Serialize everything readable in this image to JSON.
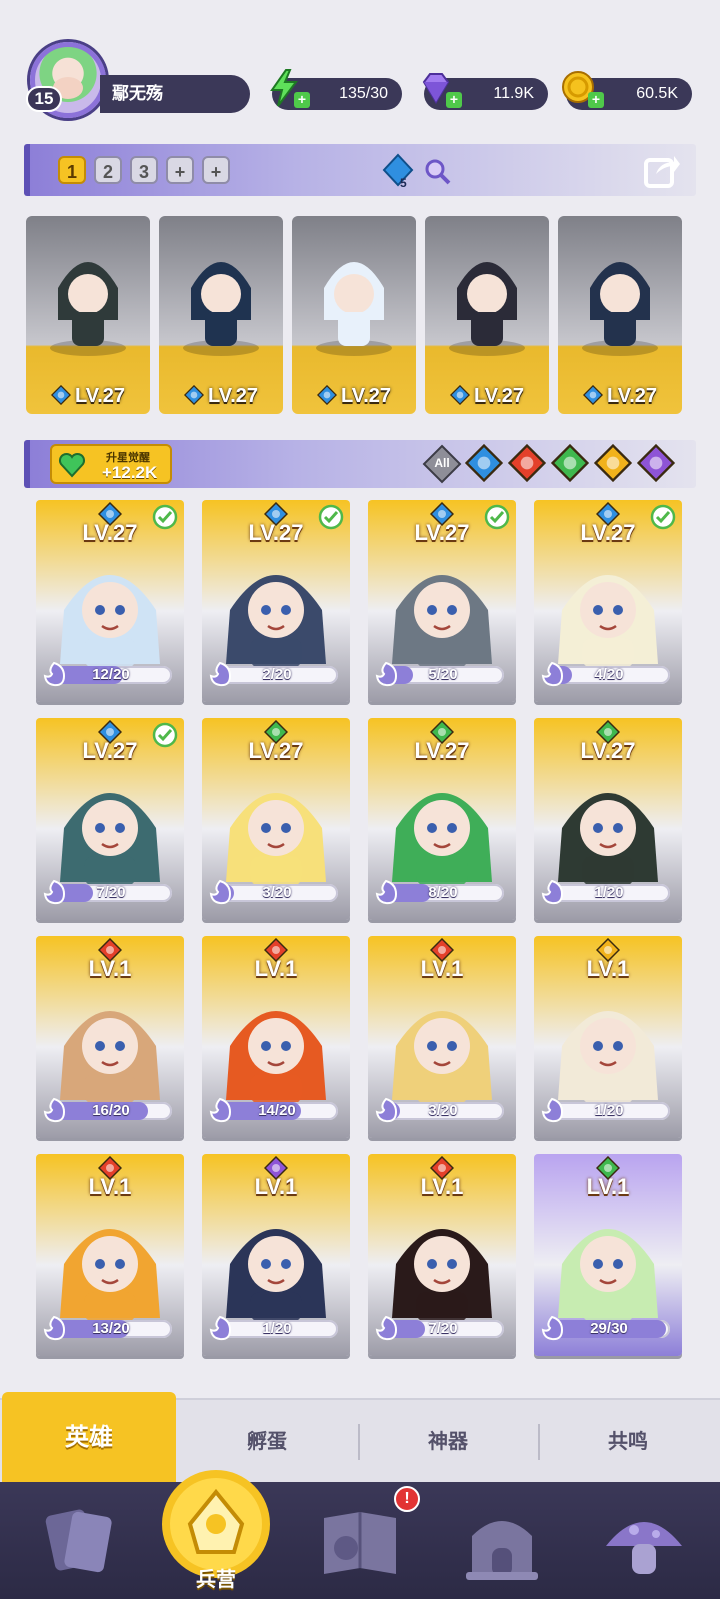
{
  "player": {
    "level": "15",
    "name": "鄢无殇"
  },
  "resources": [
    {
      "icon": "energy-bolt-icon",
      "value": "135/30"
    },
    {
      "icon": "diamond-icon",
      "value": "11.9K"
    },
    {
      "icon": "gold-coin-icon",
      "value": "60.5K"
    }
  ],
  "team_bar": {
    "slots": [
      "1",
      "2",
      "3",
      "+",
      "+"
    ],
    "active_slot": "1",
    "gem_count": "5"
  },
  "team_heroes": [
    {
      "level": "LV.27",
      "element": "water"
    },
    {
      "level": "LV.27",
      "element": "water"
    },
    {
      "level": "LV.27",
      "element": "water"
    },
    {
      "level": "LV.27",
      "element": "water"
    },
    {
      "level": "LV.27",
      "element": "water"
    }
  ],
  "awaken": {
    "label": "升星觉醒",
    "value": "+12.2K"
  },
  "filters": [
    "All",
    "water",
    "fire",
    "wind",
    "light",
    "dark"
  ],
  "colors": {
    "water": "#2f8fe0",
    "fire": "#e4402a",
    "wind": "#3fb84e",
    "light": "#f1b21b",
    "dark": "#8e54d6",
    "gold": "#f6c323",
    "purple": "#8d7fd8"
  },
  "heroes": [
    {
      "level": "LV.27",
      "element": "water",
      "shards": "12/20",
      "progress": 0.6,
      "checked": true,
      "rarity": "gold",
      "hair": "#cfe3f5"
    },
    {
      "level": "LV.27",
      "element": "water",
      "shards": "2/20",
      "progress": 0.1,
      "checked": true,
      "rarity": "gold",
      "hair": "#3b4a6b"
    },
    {
      "level": "LV.27",
      "element": "water",
      "shards": "5/20",
      "progress": 0.25,
      "checked": true,
      "rarity": "gold",
      "hair": "#6d7884"
    },
    {
      "level": "LV.27",
      "element": "water",
      "shards": "4/20",
      "progress": 0.2,
      "checked": true,
      "rarity": "gold",
      "hair": "#f4efd6"
    },
    {
      "level": "LV.27",
      "element": "water",
      "shards": "7/20",
      "progress": 0.35,
      "checked": true,
      "rarity": "gold",
      "hair": "#3d6b70"
    },
    {
      "level": "LV.27",
      "element": "wind",
      "shards": "3/20",
      "progress": 0.15,
      "checked": false,
      "rarity": "gold",
      "hair": "#f7e07a"
    },
    {
      "level": "LV.27",
      "element": "wind",
      "shards": "8/20",
      "progress": 0.4,
      "checked": false,
      "rarity": "gold",
      "hair": "#3fae58"
    },
    {
      "level": "LV.27",
      "element": "wind",
      "shards": "1/20",
      "progress": 0.05,
      "checked": false,
      "rarity": "gold",
      "hair": "#2e3a33"
    },
    {
      "level": "LV.1",
      "element": "fire",
      "shards": "16/20",
      "progress": 0.8,
      "checked": false,
      "rarity": "gold",
      "hair": "#d8a77a"
    },
    {
      "level": "LV.1",
      "element": "fire",
      "shards": "14/20",
      "progress": 0.7,
      "checked": false,
      "rarity": "gold",
      "hair": "#e65a22"
    },
    {
      "level": "LV.1",
      "element": "fire",
      "shards": "3/20",
      "progress": 0.15,
      "checked": false,
      "rarity": "gold",
      "hair": "#efd07a"
    },
    {
      "level": "LV.1",
      "element": "light",
      "shards": "1/20",
      "progress": 0.05,
      "checked": false,
      "rarity": "gold",
      "hair": "#f2ead8"
    },
    {
      "level": "LV.1",
      "element": "fire",
      "shards": "13/20",
      "progress": 0.65,
      "checked": false,
      "rarity": "gold",
      "hair": "#f1a531"
    },
    {
      "level": "LV.1",
      "element": "dark",
      "shards": "1/20",
      "progress": 0.05,
      "checked": false,
      "rarity": "gold",
      "hair": "#2b3558"
    },
    {
      "level": "LV.1",
      "element": "fire",
      "shards": "7/20",
      "progress": 0.35,
      "checked": false,
      "rarity": "gold",
      "hair": "#2a1a1a"
    },
    {
      "level": "LV.1",
      "element": "wind",
      "shards": "29/30",
      "progress": 0.97,
      "checked": false,
      "rarity": "purple",
      "hair": "#c7ecb1"
    }
  ],
  "sub_tabs": [
    "英雄",
    "孵蛋",
    "神器",
    "共鸣"
  ],
  "nav": {
    "items": [
      "cards-icon",
      "barracks-icon",
      "map-book-icon",
      "castle-icon",
      "mushroom-icon"
    ],
    "active_label": "兵营",
    "alert": "!"
  }
}
